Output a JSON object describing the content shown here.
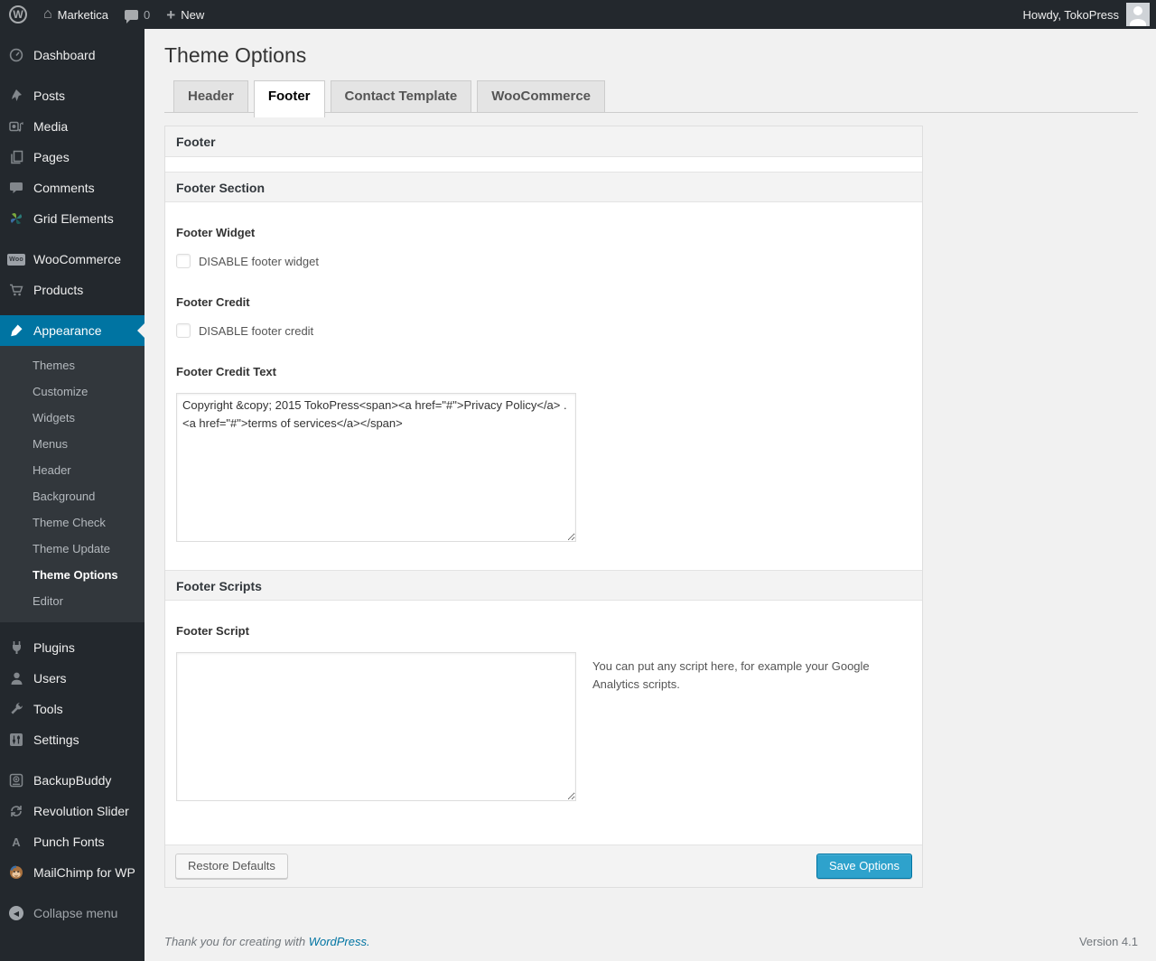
{
  "admin_bar": {
    "site_name": "Marketica",
    "comment_count": "0",
    "new_label": "New",
    "howdy_text": "Howdy, TokoPress"
  },
  "sidebar": {
    "items": [
      "Dashboard",
      "Posts",
      "Media",
      "Pages",
      "Comments",
      "Grid Elements",
      "WooCommerce",
      "Products",
      "Appearance",
      "Plugins",
      "Users",
      "Tools",
      "Settings",
      "BackupBuddy",
      "Revolution Slider",
      "Punch Fonts",
      "MailChimp for WP"
    ],
    "appearance_submenu": [
      "Themes",
      "Customize",
      "Widgets",
      "Menus",
      "Header",
      "Background",
      "Theme Check",
      "Theme Update",
      "Theme Options",
      "Editor"
    ],
    "current_item": "Appearance",
    "current_submenu_item": "Theme Options",
    "woo_badge": "Woo",
    "collapse_label": "Collapse menu"
  },
  "page": {
    "title": "Theme Options",
    "tabs": [
      "Header",
      "Footer",
      "Contact Template",
      "WooCommerce"
    ],
    "active_tab": "Footer",
    "panel_title": "Footer",
    "footer_section": {
      "title": "Footer Section",
      "footer_widget_label": "Footer Widget",
      "footer_widget_checkbox_label": "DISABLE footer widget",
      "footer_widget_checked": false,
      "footer_credit_label": "Footer Credit",
      "footer_credit_checkbox_label": "DISABLE footer credit",
      "footer_credit_checked": false,
      "footer_credit_text_label": "Footer Credit Text",
      "footer_credit_text_value": "Copyright &copy; 2015 TokoPress<span><a href=\"#\">Privacy Policy</a> . <a href=\"#\">terms of services</a></span>"
    },
    "footer_scripts": {
      "title": "Footer Scripts",
      "footer_script_label": "Footer Script",
      "footer_script_value": "",
      "footer_script_help": "You can put any script here, for example your Google Analytics scripts."
    },
    "buttons": {
      "restore": "Restore Defaults",
      "save": "Save Options"
    }
  },
  "page_footer": {
    "thankyou_prefix": "Thank you for creating with ",
    "wordpress_link": "WordPress.",
    "version": "Version 4.1"
  },
  "colors": {
    "accent_blue": "#0074a2",
    "primary_button": "#2ea2cc",
    "admin_bar_bg": "#23282d",
    "submenu_bg": "#32373c",
    "body_bg": "#f1f1f1"
  }
}
